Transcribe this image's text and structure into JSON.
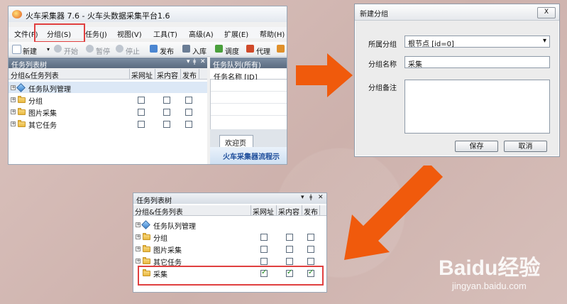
{
  "main_window": {
    "title": "火车采集器 7.6 - 火车头数据采集平台1.6",
    "menu": [
      "文件(F)",
      "分组(S)",
      "任务(J)",
      "视图(V)",
      "工具(T)",
      "高级(A)",
      "扩展(E)",
      "帮助(H)"
    ],
    "toolbar": [
      "新建",
      "开始",
      "暂停",
      "停止",
      "发布",
      "入库",
      "调度",
      "代理"
    ],
    "tree_panel_title": "任务列表树",
    "queue_panel_title": "任务队列(所有)",
    "queue_column": "任务名称 [ID]",
    "columns": [
      "分组&任务列表",
      "采网址",
      "采内容",
      "发布"
    ],
    "rows": [
      "任务队列管理",
      "分组",
      "图片采集",
      "其它任务"
    ],
    "welcome_tab": "欢迎页",
    "welcome_banner": "火车采集器流程示"
  },
  "dialog": {
    "title": "新建分组",
    "close_label": "X",
    "parent_label": "所属分组",
    "parent_value": "根节点 [id=0]",
    "name_label": "分组名称",
    "name_value": "采集",
    "note_label": "分组备注",
    "note_value": "",
    "save_label": "保存",
    "cancel_label": "取消"
  },
  "result_panel": {
    "title": "任务列表树",
    "columns": [
      "分组&任务列表",
      "采网址",
      "采内容",
      "发布"
    ],
    "rows": [
      "任务队列管理",
      "分组",
      "图片采集",
      "其它任务",
      "采集"
    ]
  },
  "watermark": {
    "brand": "Baidu经验",
    "url": "jingyan.baidu.com"
  },
  "colors": {
    "highlight": "#e04040",
    "arrow": "#f05a0c",
    "panel_header": "#5a6b80"
  }
}
